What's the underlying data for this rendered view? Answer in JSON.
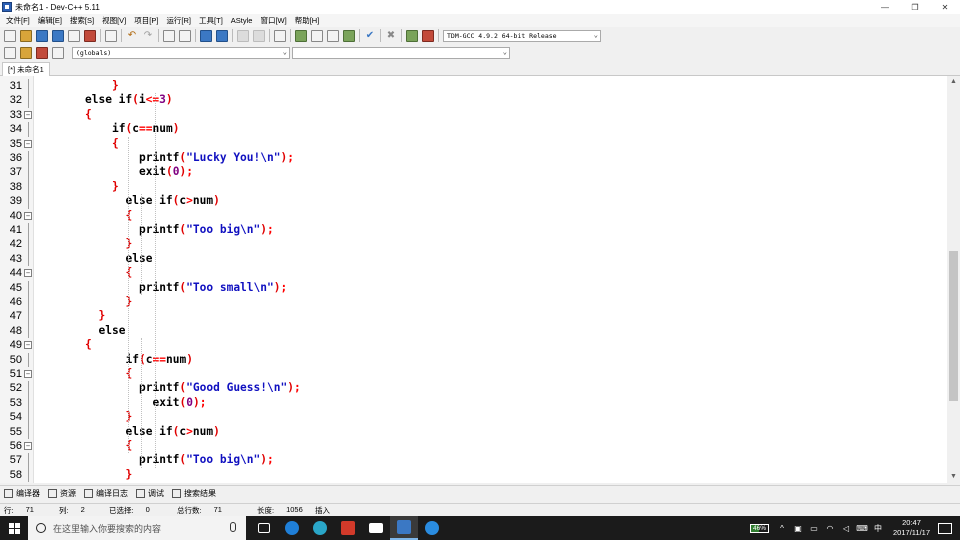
{
  "window": {
    "title": "未命名1 - Dev-C++ 5.11",
    "min": "—",
    "restore": "❐",
    "close": "✕"
  },
  "menu": [
    "文件[F]",
    "编辑[E]",
    "搜索[S]",
    "视图[V]",
    "项目[P]",
    "运行[R]",
    "工具[T]",
    "AStyle",
    "窗口[W]",
    "帮助[H]"
  ],
  "toolbar": {
    "compiler_select": "TDM-GCC 4.9.2 64-bit Release",
    "globals_select": "(globals)",
    "member_select": ""
  },
  "tabs": [
    "[*] 未命名1"
  ],
  "editor": {
    "lines": [
      {
        "n": "31",
        "fold": "",
        "indent": 6,
        "tokens": [
          [
            "br",
            "}"
          ]
        ]
      },
      {
        "n": "32",
        "fold": "",
        "indent": 4,
        "tokens": [
          [
            "kw",
            "else if"
          ],
          [
            "br",
            "("
          ],
          [
            "kw",
            "i"
          ],
          [
            "op",
            "<="
          ],
          [
            "num",
            "3"
          ],
          [
            "br",
            ")"
          ]
        ]
      },
      {
        "n": "33",
        "fold": "−",
        "indent": 4,
        "tokens": [
          [
            "br",
            "{"
          ]
        ]
      },
      {
        "n": "34",
        "fold": "",
        "indent": 6,
        "tokens": [
          [
            "kw",
            "if"
          ],
          [
            "br",
            "("
          ],
          [
            "kw",
            "c"
          ],
          [
            "op",
            "=="
          ],
          [
            "kw",
            "num"
          ],
          [
            "br",
            ")"
          ]
        ]
      },
      {
        "n": "35",
        "fold": "−",
        "indent": 6,
        "tokens": [
          [
            "br",
            "{"
          ]
        ]
      },
      {
        "n": "36",
        "fold": "",
        "indent": 8,
        "tokens": [
          [
            "kw",
            "printf"
          ],
          [
            "br",
            "("
          ],
          [
            "str",
            "\"Lucky You!\\n\""
          ],
          [
            "br",
            ")"
          ],
          [
            "op",
            ";"
          ]
        ]
      },
      {
        "n": "37",
        "fold": "",
        "indent": 8,
        "tokens": [
          [
            "kw",
            "exit"
          ],
          [
            "br",
            "("
          ],
          [
            "num",
            "0"
          ],
          [
            "br",
            ")"
          ],
          [
            "op",
            ";"
          ]
        ]
      },
      {
        "n": "38",
        "fold": "",
        "indent": 6,
        "tokens": [
          [
            "br",
            "}"
          ]
        ]
      },
      {
        "n": "39",
        "fold": "",
        "indent": 7,
        "tokens": [
          [
            "kw",
            "else if"
          ],
          [
            "br",
            "("
          ],
          [
            "kw",
            "c"
          ],
          [
            "op",
            ">"
          ],
          [
            "kw",
            "num"
          ],
          [
            "br",
            ")"
          ]
        ]
      },
      {
        "n": "40",
        "fold": "−",
        "indent": 7,
        "tokens": [
          [
            "br",
            "{"
          ]
        ]
      },
      {
        "n": "41",
        "fold": "",
        "indent": 8,
        "tokens": [
          [
            "kw",
            "printf"
          ],
          [
            "br",
            "("
          ],
          [
            "str",
            "\"Too big\\n\""
          ],
          [
            "br",
            ")"
          ],
          [
            "op",
            ";"
          ]
        ]
      },
      {
        "n": "42",
        "fold": "",
        "indent": 7,
        "tokens": [
          [
            "br",
            "}"
          ]
        ]
      },
      {
        "n": "43",
        "fold": "",
        "indent": 7,
        "tokens": [
          [
            "kw",
            "else"
          ]
        ]
      },
      {
        "n": "44",
        "fold": "−",
        "indent": 7,
        "tokens": [
          [
            "br",
            "{"
          ]
        ]
      },
      {
        "n": "45",
        "fold": "",
        "indent": 8,
        "tokens": [
          [
            "kw",
            "printf"
          ],
          [
            "br",
            "("
          ],
          [
            "str",
            "\"Too small\\n\""
          ],
          [
            "br",
            ")"
          ],
          [
            "op",
            ";"
          ]
        ]
      },
      {
        "n": "46",
        "fold": "",
        "indent": 7,
        "tokens": [
          [
            "br",
            "}"
          ]
        ]
      },
      {
        "n": "47",
        "fold": "",
        "indent": 5,
        "tokens": [
          [
            "br",
            "}"
          ]
        ]
      },
      {
        "n": "48",
        "fold": "",
        "indent": 5,
        "tokens": [
          [
            "kw",
            "else"
          ]
        ]
      },
      {
        "n": "49",
        "fold": "−",
        "indent": 4,
        "tokens": [
          [
            "br",
            "{"
          ]
        ]
      },
      {
        "n": "50",
        "fold": "",
        "indent": 7,
        "tokens": [
          [
            "kw",
            "if"
          ],
          [
            "br",
            "("
          ],
          [
            "kw",
            "c"
          ],
          [
            "op",
            "=="
          ],
          [
            "kw",
            "num"
          ],
          [
            "br",
            ")"
          ]
        ]
      },
      {
        "n": "51",
        "fold": "−",
        "indent": 7,
        "tokens": [
          [
            "br",
            "{"
          ]
        ]
      },
      {
        "n": "52",
        "fold": "",
        "indent": 8,
        "tokens": [
          [
            "kw",
            "printf"
          ],
          [
            "br",
            "("
          ],
          [
            "str",
            "\"Good Guess!\\n\""
          ],
          [
            "br",
            ")"
          ],
          [
            "op",
            ";"
          ]
        ]
      },
      {
        "n": "53",
        "fold": "",
        "indent": 9,
        "tokens": [
          [
            "kw",
            "exit"
          ],
          [
            "br",
            "("
          ],
          [
            "num",
            "0"
          ],
          [
            "br",
            ")"
          ],
          [
            "op",
            ";"
          ]
        ]
      },
      {
        "n": "54",
        "fold": "",
        "indent": 7,
        "tokens": [
          [
            "br",
            "}"
          ]
        ]
      },
      {
        "n": "55",
        "fold": "",
        "indent": 7,
        "tokens": [
          [
            "kw",
            "else if"
          ],
          [
            "br",
            "("
          ],
          [
            "kw",
            "c"
          ],
          [
            "op",
            ">"
          ],
          [
            "kw",
            "num"
          ],
          [
            "br",
            ")"
          ]
        ]
      },
      {
        "n": "56",
        "fold": "−",
        "indent": 7,
        "tokens": [
          [
            "br",
            "{"
          ]
        ]
      },
      {
        "n": "57",
        "fold": "",
        "indent": 8,
        "tokens": [
          [
            "kw",
            "printf"
          ],
          [
            "br",
            "("
          ],
          [
            "str",
            "\"Too big\\n\""
          ],
          [
            "br",
            ")"
          ],
          [
            "op",
            ";"
          ]
        ]
      },
      {
        "n": "58",
        "fold": "",
        "indent": 7,
        "tokens": [
          [
            "br",
            "}"
          ]
        ]
      }
    ]
  },
  "bottom_tabs": [
    "编译器",
    "资源",
    "编译日志",
    "调试",
    "搜索结果"
  ],
  "status": {
    "row_label": "行:",
    "row": "71",
    "col_label": "列:",
    "col": "2",
    "sel_label": "已选择:",
    "sel": "0",
    "total_label": "总行数:",
    "total": "71",
    "len_label": "长度:",
    "len": "1056",
    "mode": "插入"
  },
  "taskbar": {
    "search_placeholder": "在这里输入你要搜索的内容",
    "battery": "46%",
    "ime": "中",
    "time": "20:47",
    "date": "2017/11/17"
  },
  "colors": {
    "keyword": "#000000",
    "bracket": "#e00000",
    "string": "#1010c0",
    "number": "#800080"
  }
}
